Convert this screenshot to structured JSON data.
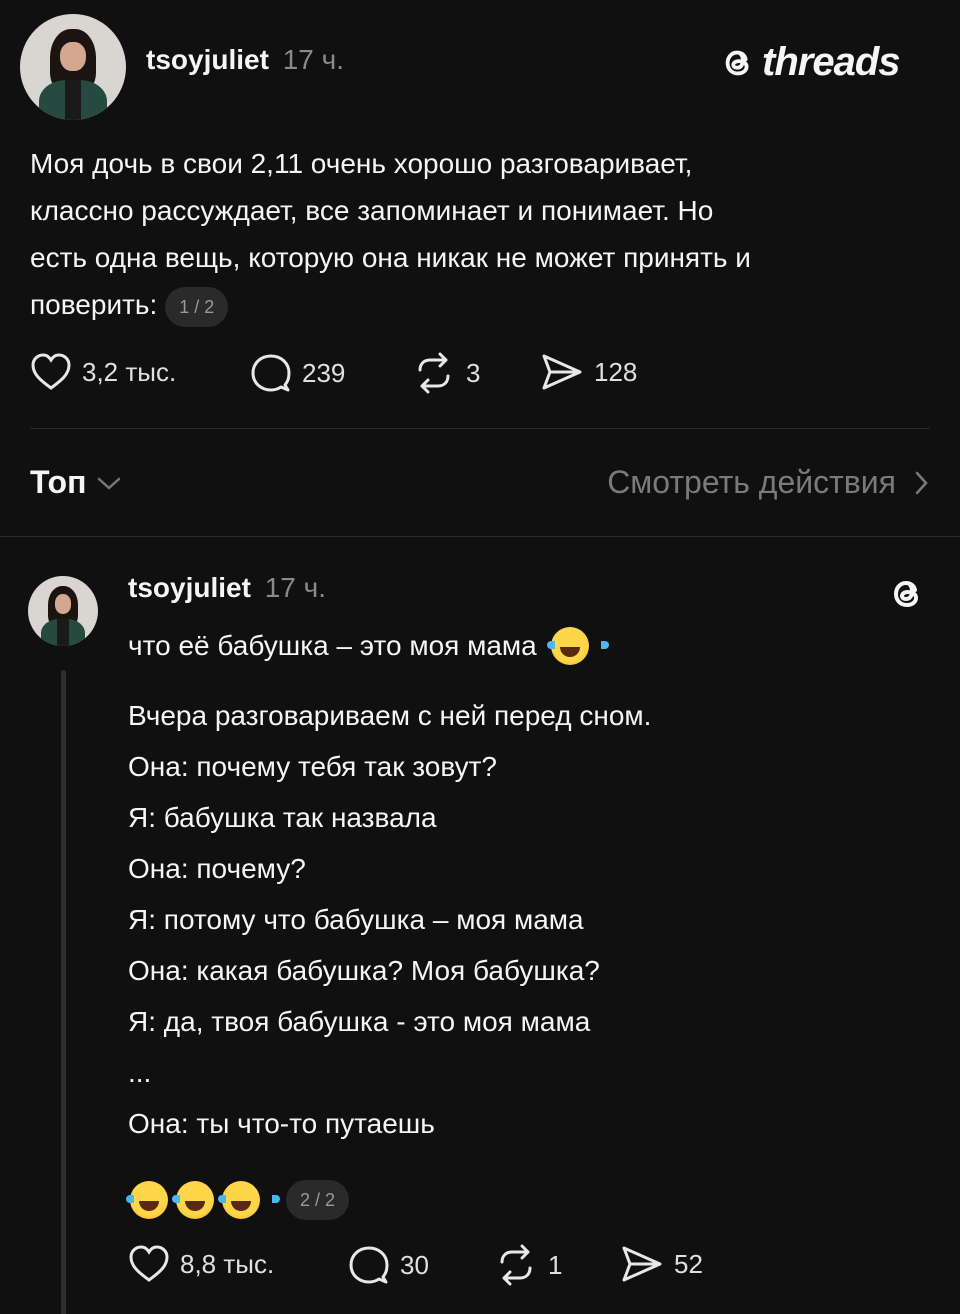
{
  "post": {
    "username": "tsoyjuliet",
    "time": "17 ч.",
    "brand": "threads",
    "text": "Моя дочь в свои 2,11 очень хорошо разговаривает, классно рассуждает, все запоминает и понимает. Но есть одна вещь, которую она никак не может принять и поверить:",
    "text_lines": [
      "Моя дочь в свои 2,11 очень хорошо разговаривает,",
      "классно рассуждает, все запоминает и понимает. Но",
      "есть одна вещь, которую она никак не может принять и",
      "поверить:"
    ],
    "page_badge": "1 / 2",
    "likes": "3,2 тыс.",
    "comments": "239",
    "reposts": "3",
    "shares": "128"
  },
  "sort_bar": {
    "sort_label": "Топ",
    "activity_label": "Смотреть действия"
  },
  "reply": {
    "username": "tsoyjuliet",
    "time": "17 ч.",
    "first_line": "что её бабушка – это моя мама",
    "lines": [
      "Вчера разговариваем с ней перед сном.",
      "Она: почему тебя так зовут?",
      "Я: бабушка так назвала",
      "Она: почему?",
      "Я: потому что бабушка – моя мама",
      "Она: какая бабушка? Моя бабушка?",
      "Я: да, твоя бабушка - это моя мама",
      "...",
      "Она: ты что-то путаешь"
    ],
    "page_badge": "2 / 2",
    "likes": "8,8 тыс.",
    "comments": "30",
    "reposts": "1",
    "shares": "52"
  },
  "icons": {
    "like": "heart-icon",
    "comment": "comment-bubble-icon",
    "repost": "repost-icon",
    "share": "send-icon",
    "logo": "threads-logo-icon",
    "emoji": "face-with-tears-of-joy-emoji"
  },
  "colors": {
    "background": "#101010",
    "text": "#f3f5f7",
    "muted": "#8a8a8a"
  }
}
